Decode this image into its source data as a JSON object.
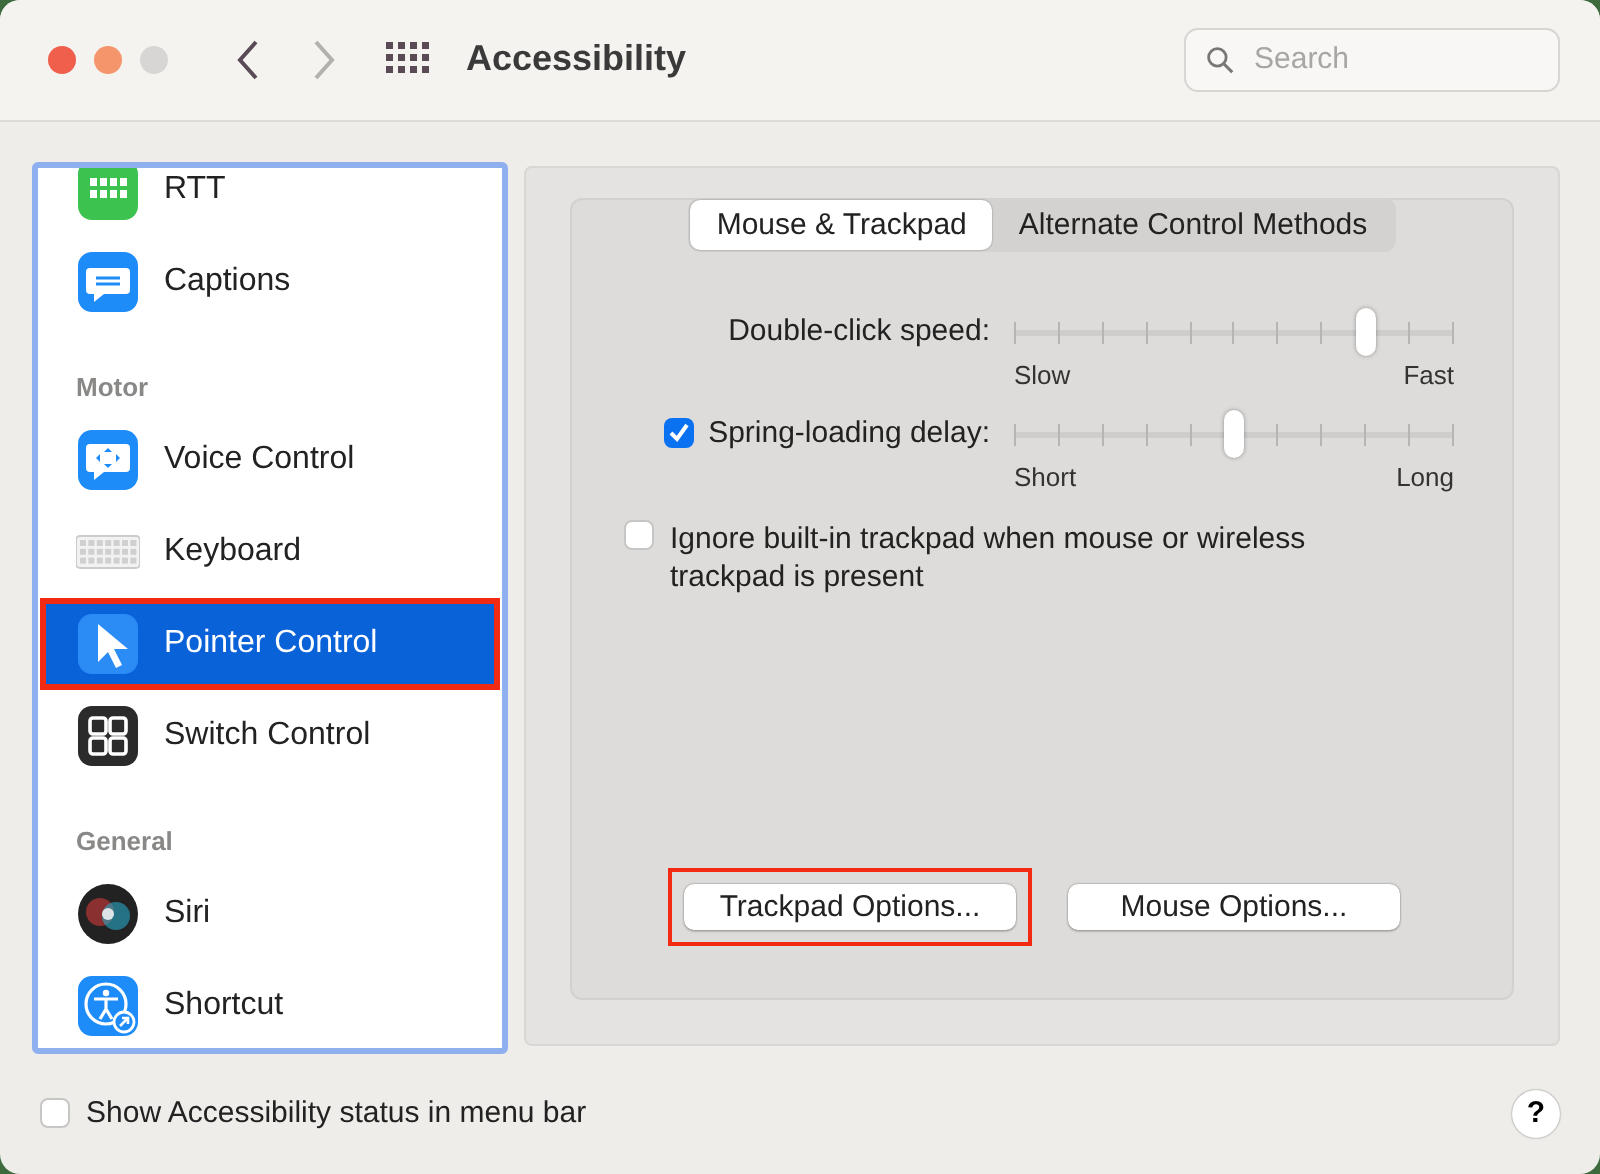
{
  "window": {
    "title": "Accessibility"
  },
  "search": {
    "placeholder": "Search"
  },
  "sidebar": {
    "sections": [
      {
        "items": [
          {
            "label": "RTT",
            "selected": false,
            "annotated": false
          },
          {
            "label": "Captions",
            "selected": false,
            "annotated": false
          }
        ]
      },
      {
        "header": "Motor",
        "items": [
          {
            "label": "Voice Control",
            "selected": false,
            "annotated": false
          },
          {
            "label": "Keyboard",
            "selected": false,
            "annotated": false
          },
          {
            "label": "Pointer Control",
            "selected": true,
            "annotated": true
          },
          {
            "label": "Switch Control",
            "selected": false,
            "annotated": false
          }
        ]
      },
      {
        "header": "General",
        "items": [
          {
            "label": "Siri",
            "selected": false,
            "annotated": false
          },
          {
            "label": "Shortcut",
            "selected": false,
            "annotated": false
          }
        ]
      }
    ]
  },
  "tabs": [
    {
      "label": "Mouse & Trackpad",
      "selected": true
    },
    {
      "label": "Alternate Control Methods",
      "selected": false
    }
  ],
  "sliders": [
    {
      "label": "Double-click speed:",
      "level": 0.8,
      "min_label": "Slow",
      "max_label": "Fast"
    },
    {
      "label": "Spring-loading delay:",
      "checked": true,
      "level": 0.5,
      "min_label": "Short",
      "max_label": "Long"
    }
  ],
  "ignore_trackpad": {
    "label": "Ignore built-in trackpad when mouse or wireless trackpad is present",
    "checked": false
  },
  "buttons": [
    {
      "label": "Trackpad Options...",
      "annotated": true
    },
    {
      "label": "Mouse Options..."
    }
  ],
  "status_checkbox": {
    "label": "Show Accessibility status in menu bar",
    "checked": false
  },
  "help": {
    "label": "?"
  }
}
